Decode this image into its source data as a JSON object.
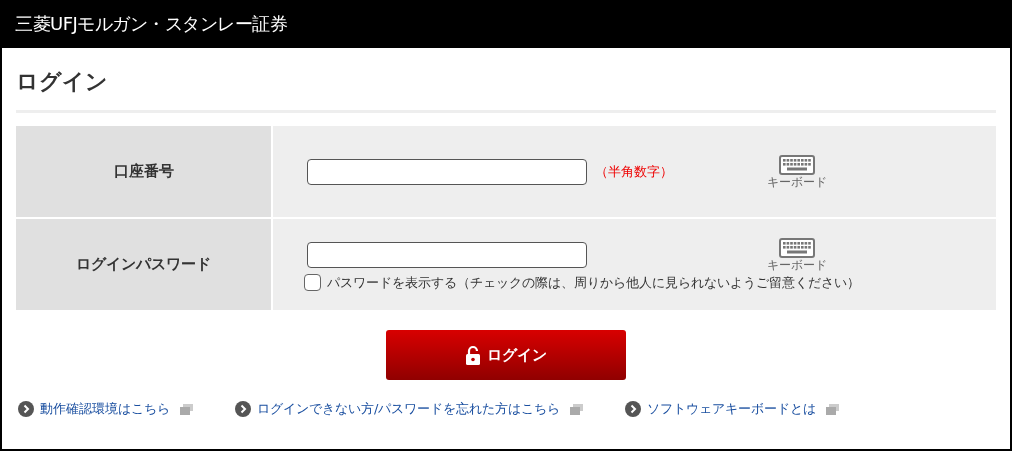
{
  "header": {
    "brand": "三菱UFJモルガン・スタンレー証券"
  },
  "page_title": "ログイン",
  "form": {
    "rows": [
      {
        "label": "口座番号",
        "value": "",
        "note": "（半角数字）",
        "keyboard_label": "キーボード"
      },
      {
        "label": "ログインパスワード",
        "value": "",
        "keyboard_label": "キーボード",
        "show_password": {
          "label": "パスワードを表示する（チェックの際は、周りから他人に見られないようご留意ください）",
          "checked": false
        }
      }
    ]
  },
  "login_button": "ログイン",
  "links": [
    {
      "label": "動作確認環境はこちら"
    },
    {
      "label": "ログインできない方/パスワードを忘れた方はこちら"
    },
    {
      "label": "ソフトウェアキーボードとは"
    }
  ]
}
